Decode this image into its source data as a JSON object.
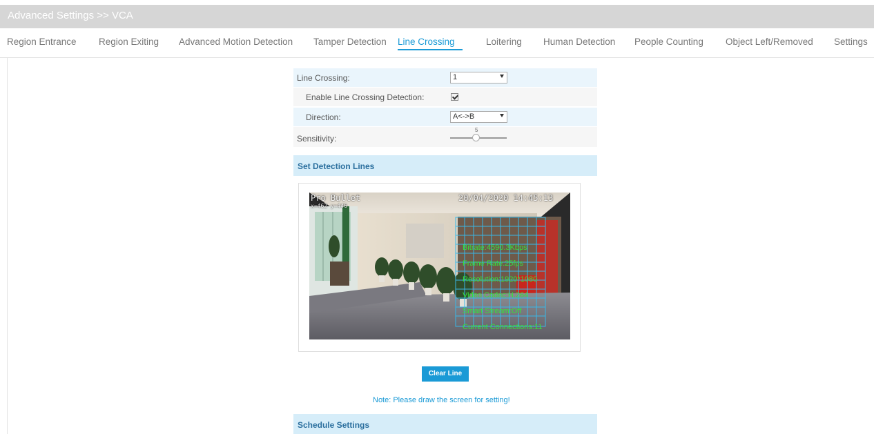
{
  "header": {
    "title": "Advanced Settings >> VCA"
  },
  "tabs": [
    {
      "label": "Region Entrance"
    },
    {
      "label": "Region Exiting"
    },
    {
      "label": "Advanced Motion Detection"
    },
    {
      "label": "Tamper Detection"
    },
    {
      "label": "Line Crossing",
      "active": true
    },
    {
      "label": "Loitering"
    },
    {
      "label": "Human Detection"
    },
    {
      "label": "People Counting"
    },
    {
      "label": "Object Left/Removed"
    },
    {
      "label": "Settings"
    }
  ],
  "form": {
    "line_crossing": {
      "label": "Line Crossing:",
      "value": "1"
    },
    "enable": {
      "label": "Enable Line Crossing Detection:",
      "checked": true
    },
    "direction": {
      "label": "Direction:",
      "value": "A<->B"
    },
    "sensitivity": {
      "label": "Sensitivity:",
      "value": "5",
      "level": 0.5
    }
  },
  "sections": {
    "detection_lines": "Set Detection Lines",
    "schedule": "Schedule Settings"
  },
  "video": {
    "camera_name": "Pro Bullet",
    "timestamp": "20/04/2020 14:45:13",
    "osd_line2": "x=462 y=446",
    "overlay": [
      "Bitrate:4590.3Kbps",
      "Frame Rate:25fps",
      "Resolution:1920*1080",
      "Video Codec:H.264",
      "Smart Stream:Off",
      "Current Connections:11"
    ]
  },
  "buttons": {
    "clear_line": "Clear Line"
  },
  "note": "Note: Please draw the screen for setting!",
  "colors": {
    "accent": "#1a9ad6",
    "header_bg": "#d6d6d6",
    "section_bg": "#d6edf9",
    "overlay_green": "#35e23b"
  }
}
